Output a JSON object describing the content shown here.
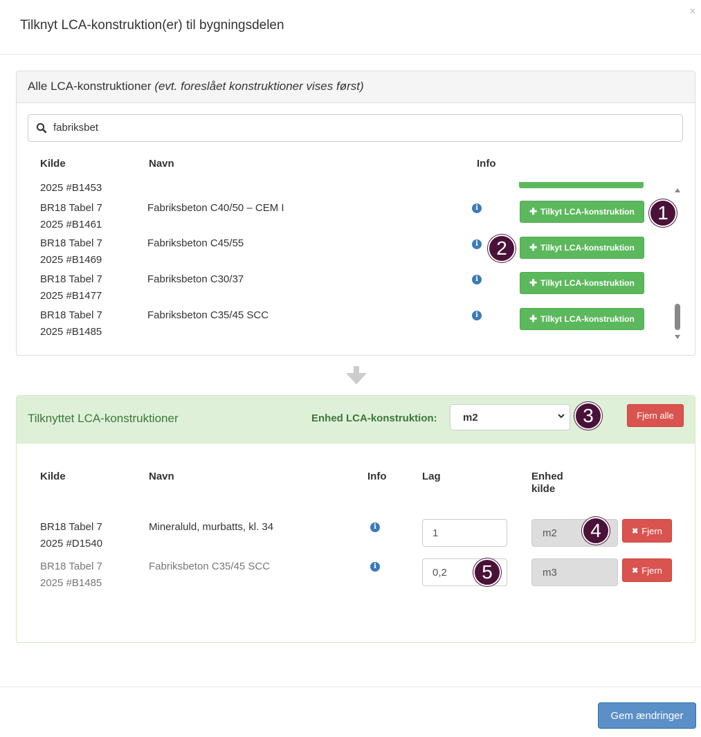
{
  "modal": {
    "title": "Tilknyt LCA-konstruktion(er) til bygningsdelen",
    "close": "×",
    "save_label": "Gem ændringer"
  },
  "all_panel": {
    "title": "Alle LCA-konstruktioner",
    "subtitle": "(evt. foreslået konstruktioner vises først)",
    "search_value": "fabriksbet",
    "columns": {
      "kilde": "Kilde",
      "navn": "Navn",
      "info": "Info"
    },
    "partial_row_kilde2": "2025 #B1453",
    "rows": [
      {
        "kilde1": "BR18 Tabel 7",
        "kilde2": "2025 #B1461",
        "navn": "Fabriksbeton C40/50 – CEM I",
        "button": "Tilkyt LCA-konstruktion"
      },
      {
        "kilde1": "BR18 Tabel 7",
        "kilde2": "2025 #B1469",
        "navn": "Fabriksbeton C45/55",
        "button": "Tilkyt LCA-konstruktion"
      },
      {
        "kilde1": "BR18 Tabel 7",
        "kilde2": "2025 #B1477",
        "navn": "Fabriksbeton C30/37",
        "button": "Tilkyt LCA-konstruktion"
      },
      {
        "kilde1": "BR18 Tabel 7",
        "kilde2": "2025 #B1485",
        "navn": "Fabriksbeton C35/45 SCC",
        "button": "Tilkyt LCA-konstruktion"
      }
    ]
  },
  "linked_panel": {
    "title": "Tilknyttet LCA-konstruktioner",
    "unit_label": "Enhed LCA-konstruktion:",
    "unit_value": "m2",
    "remove_all": "Fjern alle",
    "columns": {
      "kilde": "Kilde",
      "navn": "Navn",
      "info": "Info",
      "lag": "Lag",
      "enhed1": "Enhed",
      "enhed2": "kilde"
    },
    "rows": [
      {
        "kilde1": "BR18 Tabel 7",
        "kilde2": "2025 #D1540",
        "navn": "Mineraluld, murbatts, kl. 34",
        "lag": "1",
        "enhed": "m2",
        "remove": "Fjern"
      },
      {
        "kilde1": "BR18 Tabel 7",
        "kilde2": "2025 #B1485",
        "navn": "Fabriksbeton C35/45 SCC",
        "lag": "0,2",
        "enhed": "m3",
        "remove": "Fjern"
      }
    ]
  },
  "badges": [
    "1",
    "2",
    "3",
    "4",
    "5"
  ],
  "icons": {
    "search": "search-icon",
    "info": "info-icon",
    "plus": "plus-icon",
    "remove": "times-icon",
    "arrow": "arrow-down-icon"
  },
  "colors": {
    "green": "#5cb85c",
    "red": "#d9534f",
    "blue": "#5b8fc7",
    "badge": "#4a1238",
    "success_bg": "#dff0d8"
  }
}
